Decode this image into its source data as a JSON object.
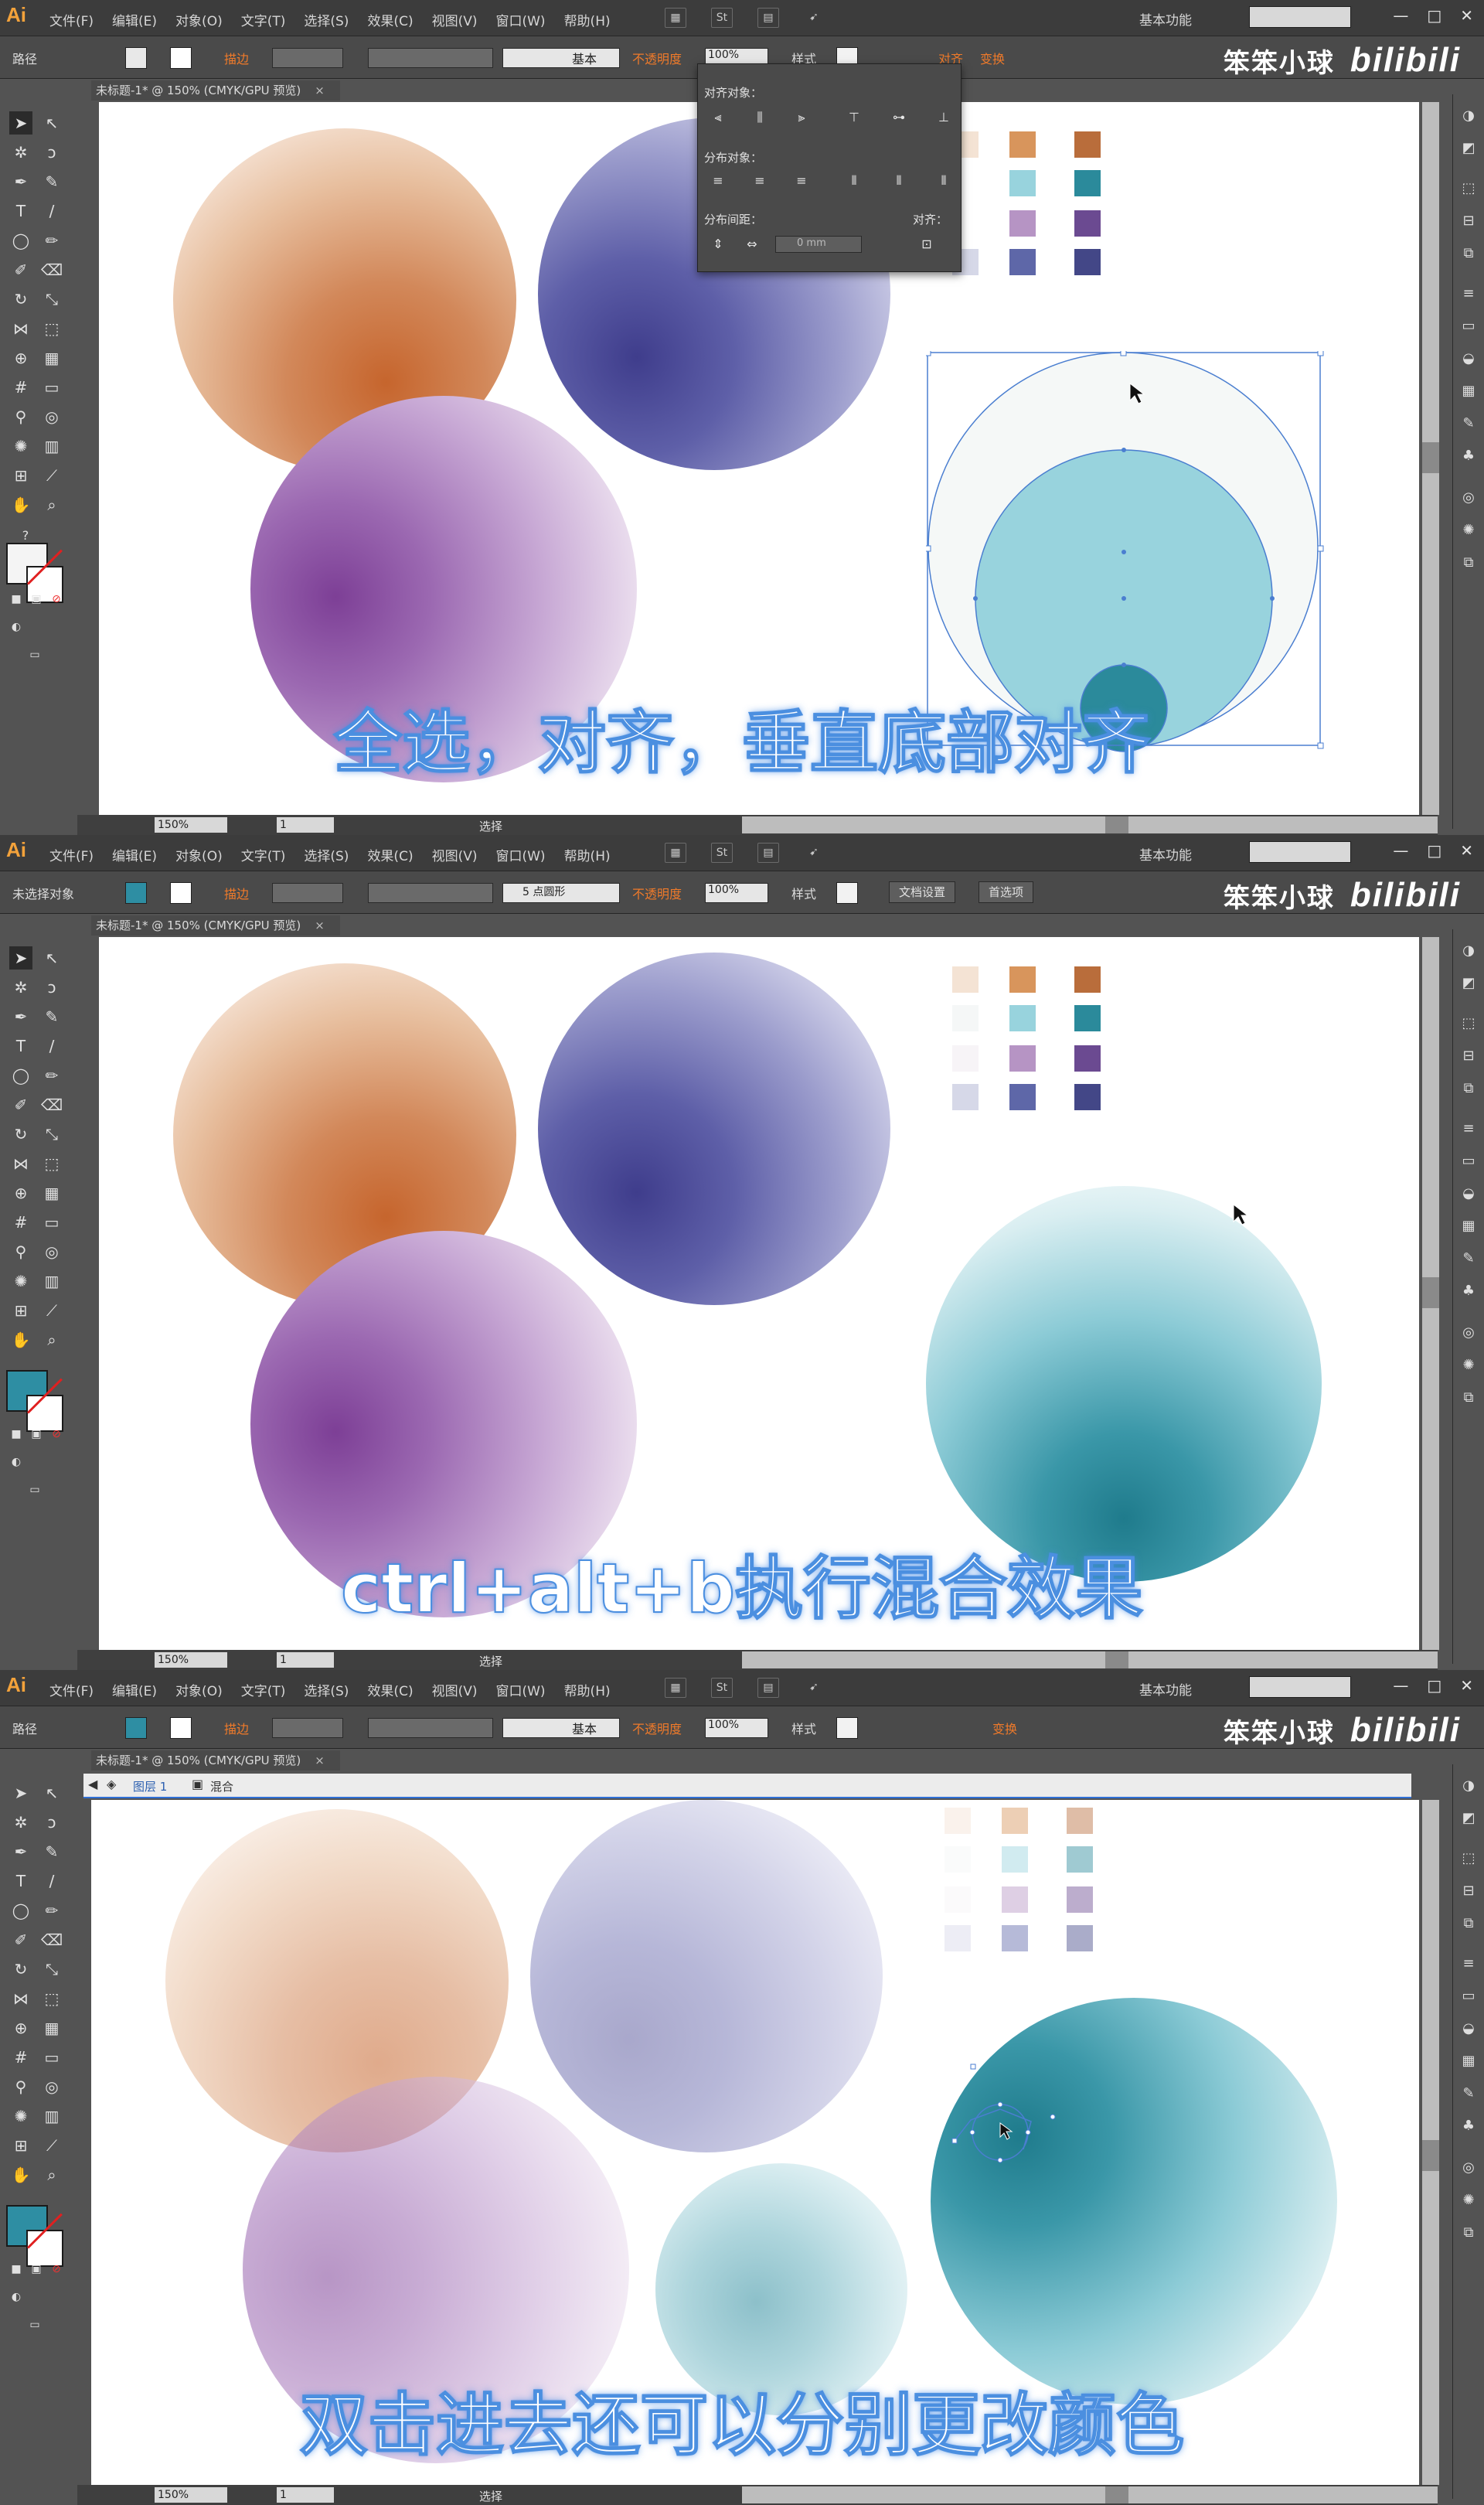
{
  "app": {
    "logo": "Ai",
    "menu": [
      "文件(F)",
      "编辑(E)",
      "对象(O)",
      "文字(T)",
      "选择(S)",
      "效果(C)",
      "视图(V)",
      "窗口(W)",
      "帮助(H)"
    ],
    "workspace": "基本功能",
    "brand_name": "笨笨小球",
    "brand_site": "bilibili",
    "doc_tab": "未标题-1* @ 150% (CMYK/GPU 预览)",
    "zoom": "150%",
    "page": "1",
    "status_text": "选择"
  },
  "frame1": {
    "ctrl_label": "路径",
    "stroke_label": "描边",
    "stroke_style": "基本",
    "opacity_label": "不透明度",
    "opacity_value": "100%",
    "style_label": "样式",
    "align_label": "对齐",
    "transform_label": "变换",
    "align_panel": {
      "align_objects": "对齐对象：",
      "distribute_objects": "分布对象：",
      "distribute_spacing": "分布间距：",
      "align_to": "对齐：",
      "spacing_value": "0 mm"
    },
    "subtitle": "全选，对齐，垂直底部对齐"
  },
  "frame2": {
    "ctrl_label": "未选择对象",
    "stroke_label": "描边",
    "stroke_style": "5 点圆形",
    "opacity_label": "不透明度",
    "opacity_value": "100%",
    "style_label": "样式",
    "doc_setup_button": "文档设置",
    "prefs_button": "首选项",
    "subtitle": "ctrl+alt+b执行混合效果"
  },
  "frame3": {
    "ctrl_label": "路径",
    "stroke_label": "描边",
    "stroke_style": "基本",
    "opacity_label": "不透明度",
    "opacity_value": "100%",
    "style_label": "样式",
    "transform_label": "变换",
    "breadcrumb_layer": "图层 1",
    "breadcrumb_group": "混合",
    "subtitle": "双击进去还可以分别更改颜色"
  },
  "colors": {
    "orange_light": "#f3e1d2",
    "orange_mid": "#d9955e",
    "orange_dark": "#b96d3b",
    "teal_light": "#f5f7f7",
    "teal_mid": "#98d3dd",
    "teal_dark": "#2b8a9b",
    "purple_light": "#f7f4f7",
    "purple_mid": "#b694c4",
    "purple_dark": "#6b4a91",
    "blue_light": "#d6d8e8",
    "blue_mid": "#5e67a8",
    "blue_dark": "#434787",
    "fill_swatch": "#2e8ea3",
    "subtitle_glow": "#4b8fe0"
  }
}
